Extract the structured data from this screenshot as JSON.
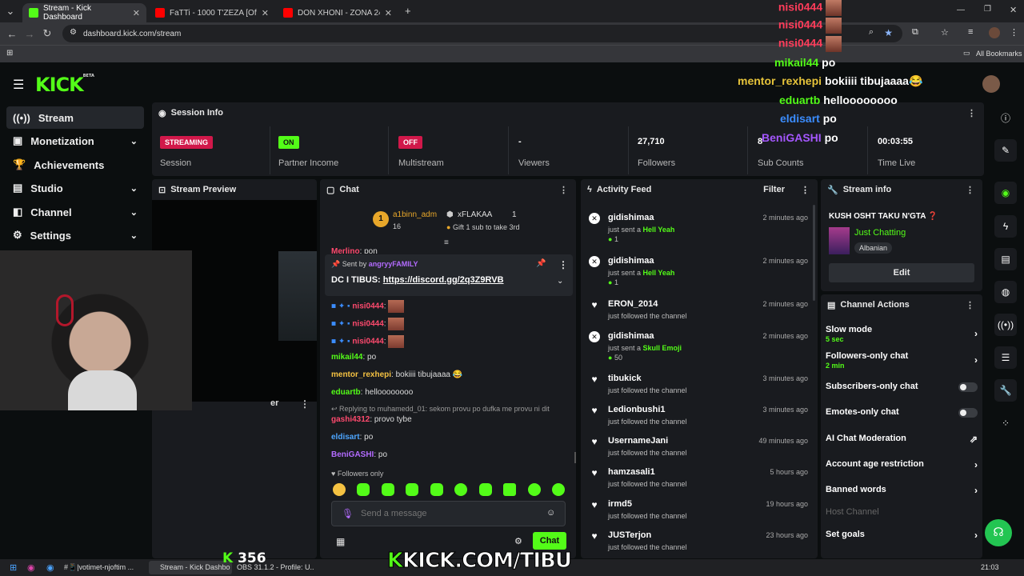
{
  "browser": {
    "tabs": [
      {
        "title": "Stream - Kick Dashboard",
        "color": "#53fc18"
      },
      {
        "title": "FaTTi - 1000 T'ZEZA [Official Vi",
        "color": "#ff0000"
      },
      {
        "title": "DON XHONI - ZONA 24 - YouT",
        "color": "#ff0000"
      }
    ],
    "url": "dashboard.kick.com/stream",
    "bookmarks_label": "All Bookmarks"
  },
  "logo": {
    "text": "KICK",
    "beta": "BETA"
  },
  "sidebar": {
    "items": [
      {
        "label": "Stream",
        "icon": "broadcast-icon"
      },
      {
        "label": "Monetization",
        "icon": "wallet-icon"
      },
      {
        "label": "Achievements",
        "icon": "trophy-icon"
      },
      {
        "label": "Studio",
        "icon": "studio-icon"
      },
      {
        "label": "Channel",
        "icon": "channel-icon"
      },
      {
        "label": "Settings",
        "icon": "gear-icon"
      }
    ]
  },
  "session": {
    "title": "Session Info",
    "cells": [
      {
        "badge": "STREAMING",
        "label": "Session"
      },
      {
        "badge": "ON",
        "label": "Partner Income"
      },
      {
        "badge": "OFF",
        "label": "Multistream"
      },
      {
        "value": "-",
        "label": "Viewers"
      },
      {
        "value": "27,710",
        "label": "Followers"
      },
      {
        "value": "8",
        "label": "Sub Counts"
      },
      {
        "value": "00:03:55",
        "label": "Time Live"
      }
    ]
  },
  "preview": {
    "title": "Stream Preview",
    "truncated_label": "er"
  },
  "chat": {
    "title": "Chat",
    "top_gifter": {
      "name": "a1binn_adm",
      "rank": "1",
      "count": "16"
    },
    "gifter2": {
      "name": "xFLAKAA",
      "count": "1",
      "note": "Gift 1 sub to take 3rd"
    },
    "cut_message": {
      "user": "Merlino",
      "text": ": pon"
    },
    "pinned": {
      "sent_by": "Sent by",
      "by_user": "angryyFAMILY",
      "text": "DC I TIBUS: ",
      "link": "https://discord.gg/2q3Z9RVB"
    },
    "messages": [
      {
        "user": "nisi0444",
        "text": ":",
        "color": "#ff4a6e"
      },
      {
        "user": "nisi0444",
        "text": ":",
        "color": "#ff4a6e"
      },
      {
        "user": "nisi0444",
        "text": ":",
        "color": "#ff4a6e"
      },
      {
        "user": "mikail44",
        "text": ": po",
        "color": "#53fc18"
      },
      {
        "user": "mentor_rexhepi",
        "text": ": bokiiii tibujaaaa 😂",
        "color": "#f5c242"
      },
      {
        "user": "eduartb",
        "text": ": helloooooooo",
        "color": "#53fc18"
      },
      {
        "user": "gashi4312",
        "text": ": provo tybe",
        "color": "#ff4a6e"
      },
      {
        "user": "eldisart",
        "text": ": po",
        "color": "#4da6ff"
      },
      {
        "user": "BeniGASHI",
        "text": ": po",
        "color": "#b36bff"
      }
    ],
    "reply_note": "Replying to muhamedd_01: sekom provu po dufka me provu ni dit",
    "followers_only": "Followers only",
    "input_placeholder": "Send a message",
    "send_label": "Chat"
  },
  "activity": {
    "title": "Activity Feed",
    "filter": "Filter",
    "items": [
      {
        "name": "gidishimaa",
        "desc": "just sent a ",
        "gift": "Hell Yeah",
        "amount": "1",
        "time": "2 minutes ago",
        "type": "gift"
      },
      {
        "name": "gidishimaa",
        "desc": "just sent a ",
        "gift": "Hell Yeah",
        "amount": "1",
        "time": "2 minutes ago",
        "type": "gift"
      },
      {
        "name": "ERON_2014",
        "desc": "just followed the channel",
        "time": "2 minutes ago",
        "type": "follow"
      },
      {
        "name": "gidishimaa",
        "desc": "just sent a ",
        "gift": "Skull Emoji",
        "amount": "50",
        "time": "2 minutes ago",
        "type": "gift"
      },
      {
        "name": "tibukick",
        "desc": "just followed the channel",
        "time": "3 minutes ago",
        "type": "follow"
      },
      {
        "name": "Ledionbushi1",
        "desc": "just followed the channel",
        "time": "3 minutes ago",
        "type": "follow"
      },
      {
        "name": "UsernameJani",
        "desc": "just followed the channel",
        "time": "49 minutes ago",
        "type": "follow"
      },
      {
        "name": "hamzasali1",
        "desc": "just followed the channel",
        "time": "5 hours ago",
        "type": "follow"
      },
      {
        "name": "irmd5",
        "desc": "just followed the channel",
        "time": "19 hours ago",
        "type": "follow"
      },
      {
        "name": "JUSTerjon",
        "desc": "just followed the channel",
        "time": "23 hours ago",
        "type": "follow"
      }
    ]
  },
  "stream_info": {
    "title": "Stream info",
    "stream_title": "KUSH OSHT TAKU N'GTA ❓",
    "category": "Just Chatting",
    "tag": "Albanian",
    "edit": "Edit"
  },
  "channel_actions": {
    "title": "Channel Actions",
    "slow_mode": {
      "label": "Slow mode",
      "sub": "5 sec"
    },
    "followers_only": {
      "label": "Followers-only chat",
      "sub": "2 min"
    },
    "subscribers_only": "Subscribers-only chat",
    "emotes_only": "Emotes-only chat",
    "ai_moderation": "AI Chat Moderation",
    "age_restriction": "Account age restriction",
    "banned_words": "Banned words",
    "host_channel": "Host Channel",
    "set_goals": "Set goals"
  },
  "overlay": {
    "lines": [
      {
        "user": "nisi0444",
        "text": "",
        "color": "#ff3c5a"
      },
      {
        "user": "nisi0444",
        "text": "",
        "color": "#ff3c5a"
      },
      {
        "user": "nisi0444",
        "text": "",
        "color": "#ff3c5a"
      },
      {
        "user": "mikail44",
        "text": "po",
        "color": "#53fc18"
      },
      {
        "user": "mentor_rexhepi",
        "text": "bokiiii tibujaaaa😂",
        "color": "#e6c33a"
      },
      {
        "user": "eduartb",
        "text": "helloooooooo",
        "color": "#53fc18"
      },
      {
        "user": "eldisart",
        "text": "po",
        "color": "#3b8dff"
      },
      {
        "user": "BeniGASHI",
        "text": "po",
        "color": "#a557ff"
      }
    ],
    "viewer_count": "356",
    "brand_url": "KICK.COM/TIBU"
  },
  "taskbar": {
    "items": [
      "#📱|votimet-njoftim ...",
      "Stream - Kick Dashbo...",
      "OBS 31.1.2 - Profile: U..."
    ],
    "time": "21:03"
  }
}
